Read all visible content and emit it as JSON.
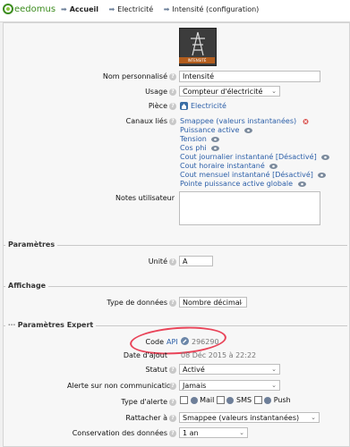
{
  "header": {
    "logo_text": "eedomus",
    "breadcrumb": [
      "Accueil",
      "Electricité",
      "Intensité (configuration)"
    ]
  },
  "device": {
    "image_label": "INTENSITÉ"
  },
  "form": {
    "name": {
      "label": "Nom personnalisé",
      "value": "Intensité"
    },
    "usage": {
      "label": "Usage",
      "value": "Compteur d'électricité"
    },
    "room": {
      "label": "Pièce",
      "value": "Electricité"
    },
    "linked": {
      "label": "Canaux liés",
      "items": [
        "Smappee (valeurs instantanées)",
        "Puissance active",
        "Tension",
        "Cos phi",
        "Cout journalier instantané [Désactivé]",
        "Cout horaire instantané",
        "Cout mensuel instantané [Désactivé]",
        "Pointe puissance active globale"
      ]
    },
    "notes": {
      "label": "Notes utilisateur",
      "value": ""
    }
  },
  "params": {
    "title": "Paramètres",
    "unit_label": "Unité",
    "unit_value": "A"
  },
  "display": {
    "title": "Affichage",
    "type_label": "Type de données",
    "type_value": "Nombre décimal"
  },
  "expert": {
    "title": "Paramètres Expert",
    "code_label": "Code",
    "api_link": "API",
    "code_value": "296290",
    "date_label": "Date d'ajout",
    "date_value": "08 Déc 2015 à 22:22",
    "status_label": "Statut",
    "status_value": "Activé",
    "alert_label": "Alerte sur non communication",
    "alert_value": "Jamais",
    "alert_type_label": "Type d'alerte",
    "alert_types": [
      "Mail",
      "SMS",
      "Push"
    ],
    "attach_label": "Rattacher à",
    "attach_value": "Smappee (valeurs instantanées)",
    "retention_label": "Conservation des données",
    "retention_value": "1 an"
  }
}
